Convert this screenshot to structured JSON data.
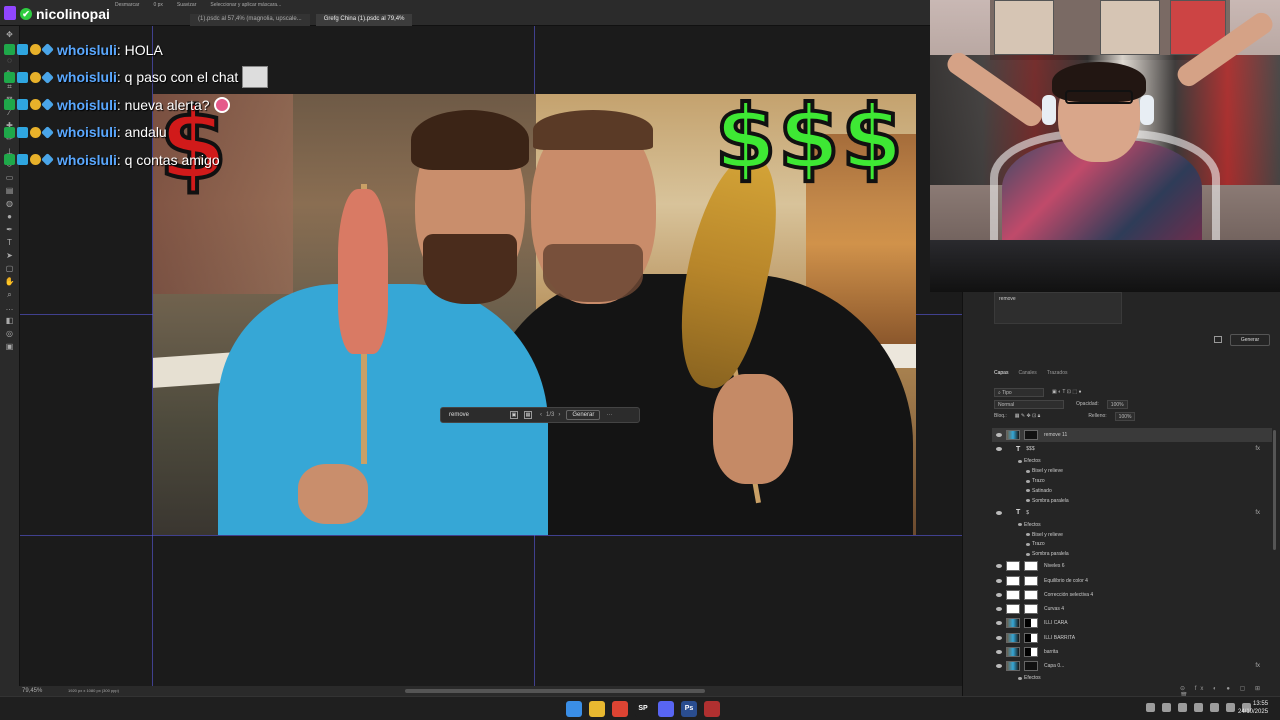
{
  "topbar": {
    "streamer_name": "nicolinopai",
    "options": [
      "Desmarcar",
      "0 px",
      "Suavizar",
      "Seleccionar y aplicar máscara..."
    ],
    "tabs": [
      {
        "label": "(1).psdc al 57,4% (magnolia, upscale..."
      },
      {
        "label": "Grefg China (1).psdc al 79,4%"
      }
    ]
  },
  "chat": {
    "messages": [
      {
        "user": "whoisluli",
        "text": ": HOLA",
        "emote": ""
      },
      {
        "user": "whoisluli",
        "text": ": q paso con el chat",
        "emote": "emote-image"
      },
      {
        "user": "whoisluli",
        "text": ": nueva alerta?",
        "emote": "emote-round"
      },
      {
        "user": "whoisluli",
        "text": ": andalu",
        "emote": ""
      },
      {
        "user": "whoisluli",
        "text": ": q contas amigo",
        "emote": ""
      }
    ]
  },
  "canvas": {
    "dollar_left": "$",
    "dollars_right": "$$$",
    "accent_red": "#d11a1a",
    "accent_green": "#3ee834"
  },
  "genbar": {
    "prompt": "remove",
    "pager": "1/3",
    "generate": "Generar",
    "more": "···"
  },
  "statusbar": {
    "zoom": "79,45%",
    "docsize": "1920 px x 1080 px (300 ppp)"
  },
  "contextual": {
    "prompt": "remove",
    "generate": "Generar"
  },
  "layers_panel": {
    "tabs": [
      "Capas",
      "Canales",
      "Trazados"
    ],
    "filter": "Tipo",
    "blend": "Normal",
    "opacity_label": "Opacidad:",
    "opacity": "100%",
    "lock_label": "Bloq.:",
    "fill_label": "Relleno:",
    "fill": "100%",
    "items": [
      {
        "name": "remove 11",
        "type": "image",
        "level": 0,
        "selected": true
      },
      {
        "name": "$$$",
        "type": "text",
        "level": 0,
        "fx": "fx"
      },
      {
        "name": "Efectos",
        "type": "effects",
        "level": 1
      },
      {
        "name": "Bisel y relieve",
        "type": "effect",
        "level": 2
      },
      {
        "name": "Trazo",
        "type": "effect",
        "level": 2
      },
      {
        "name": "Satinado",
        "type": "effect",
        "level": 2
      },
      {
        "name": "Sombra paralela",
        "type": "effect",
        "level": 2
      },
      {
        "name": "$",
        "type": "text",
        "level": 0,
        "fx": "fx"
      },
      {
        "name": "Efectos",
        "type": "effects",
        "level": 1
      },
      {
        "name": "Bisel y relieve",
        "type": "effect",
        "level": 2
      },
      {
        "name": "Trazo",
        "type": "effect",
        "level": 2
      },
      {
        "name": "Sombra paralela",
        "type": "effect",
        "level": 2
      },
      {
        "name": "Niveles 6",
        "type": "adjust",
        "level": 0
      },
      {
        "name": "Equilibrio de color 4",
        "type": "adjust",
        "level": 0
      },
      {
        "name": "Corrección selectiva 4",
        "type": "adjust",
        "level": 0
      },
      {
        "name": "Curvas 4",
        "type": "adjust",
        "level": 0
      },
      {
        "name": "ILLI CARA",
        "type": "image-mask",
        "level": 0
      },
      {
        "name": "ILLI BARRITA",
        "type": "image-mask",
        "level": 0
      },
      {
        "name": "barrita",
        "type": "image-mask",
        "level": 0
      },
      {
        "name": "Capa 0...",
        "type": "image",
        "level": 0,
        "fx": "fx"
      },
      {
        "name": "Efectos",
        "type": "effects",
        "level": 1
      }
    ]
  },
  "taskbar": {
    "apps": [
      {
        "name": "start",
        "label": "",
        "color": "#3a8ee6"
      },
      {
        "name": "explorer",
        "label": "",
        "color": "#e8b830"
      },
      {
        "name": "chrome",
        "label": "",
        "color": "#dd4433"
      },
      {
        "name": "spotify",
        "label": "SP",
        "color": "#1f1f1f"
      },
      {
        "name": "discord",
        "label": "",
        "color": "#5865f2"
      },
      {
        "name": "photoshop",
        "label": "Ps",
        "color": "#2a4d8f"
      },
      {
        "name": "obs",
        "label": "",
        "color": "#b03030"
      }
    ],
    "time": "13:55",
    "date": "24/10/2025"
  }
}
